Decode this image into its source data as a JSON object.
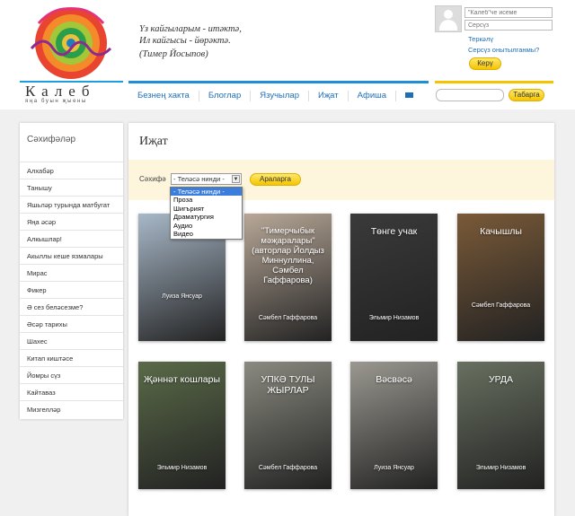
{
  "logo": {
    "name": "Калеб",
    "tagline": "яңа буын җыены"
  },
  "quote": {
    "line1": "Үз кайгыларым - итәктә,",
    "line2": "Ил кайгысы - йөрәктә.",
    "author": "(Тимер Йосыпов)"
  },
  "nav": {
    "items": [
      "Безнең хакта",
      "Блоглар",
      "Язучылар",
      "Иҗат",
      "Афиша"
    ]
  },
  "login": {
    "username_placeholder": "\"Калеб\"че исеме",
    "password_placeholder": "Серсүз",
    "mirror_link": "Теркәлү",
    "forgot_link": "Серсүз онытылганмы?",
    "submit_label": "Керү"
  },
  "search": {
    "button_label": "Табарга"
  },
  "sidebar": {
    "title": "Сәхифәләр",
    "items": [
      "Алхабәр",
      "Танышу",
      "Яшьләр турында матбугат",
      "Яңа әсәр",
      "Алкышлар!",
      "Акыллы кеше язмалары",
      "Мирас",
      "Фикер",
      "Ә сез беләсезме?",
      "Әсәр тарихы",
      "Шахес",
      "Китап киштәсе",
      "Йомры сүз",
      "Кайтаваз",
      "Мизгелләр"
    ]
  },
  "main": {
    "title": "Иҗат",
    "filter_label": "Сәхифә",
    "select_value": "- Теләсә нинди -",
    "options": [
      "- Теләсә нинди -",
      "Проза",
      "Шигърият",
      "Драматургия",
      "Аудио",
      "Видео"
    ],
    "button_label": "Араларга"
  },
  "cards": [
    {
      "title": "",
      "author": "Луиза Янсуар",
      "bg": "#a8b8c8"
    },
    {
      "title": "\"Тимерчыбык мәҗаралары\" (авторлар Йолдыз Миннуллина, Сәмбел Гаффарова)",
      "author": "Сәмбел Гаффарова",
      "bg": "#b8a898"
    },
    {
      "title": "Төнге учак",
      "author": "Эльмир Низамов",
      "bg": "#3a3a3a"
    },
    {
      "title": "Качышлы",
      "author": "Сәмбел Гаффарова",
      "bg": "#7a5a38"
    },
    {
      "title": "Җәннәт кошлары",
      "author": "Эльмир Низамов",
      "bg": "#5a6a48"
    },
    {
      "title": "УПКӘ ТУЛЫ ЖЫРЛАР",
      "author": "Сәмбел Гаффарова",
      "bg": "#8a8a80"
    },
    {
      "title": "Вәсвәсә",
      "author": "Луиза Янсуар",
      "bg": "#9a9890"
    },
    {
      "title": "УРДА",
      "author": "Эльмир Низамов",
      "bg": "#687060"
    }
  ]
}
